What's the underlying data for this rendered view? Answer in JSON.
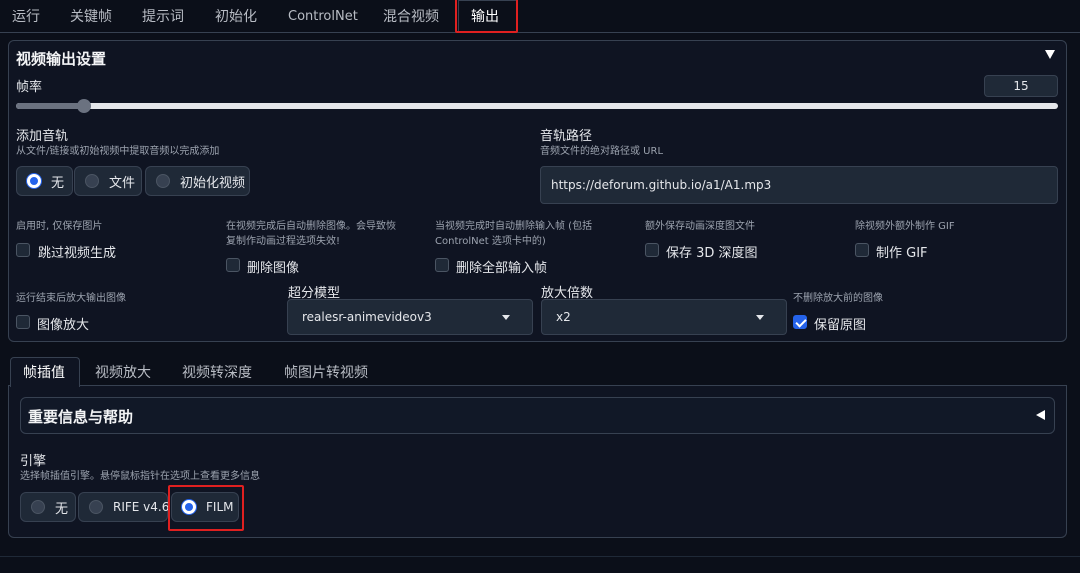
{
  "top_tabs": [
    "运行",
    "关键帧",
    "提示词",
    "初始化",
    "ControlNet",
    "混合视频",
    "输出"
  ],
  "active_top_tab": "输出",
  "output_section": {
    "title": "视频输出设置",
    "fps": {
      "label": "帧率",
      "value": "15",
      "min": 1,
      "max": 200,
      "fraction": 0.065
    },
    "add_audio": {
      "label": "添加音轨",
      "help": "从文件/链接或初始视频中提取音频以完成添加",
      "options": [
        "无",
        "文件",
        "初始化视频"
      ],
      "selected": "无"
    },
    "audio_path": {
      "label": "音轨路径",
      "help": "音频文件的绝对路径或 URL",
      "value": "https://deforum.github.io/a1/A1.mp3"
    },
    "skip_video": {
      "help": "启用时, 仅保存图片",
      "label": "跳过视频生成",
      "checked": false
    },
    "delete_imgs": {
      "help_line1": "在视频完成后自动删除图像。会导致恢",
      "help_line2": "复制作动画过程选项失效!",
      "label": "删除图像",
      "checked": false
    },
    "delete_inputs": {
      "help_line1": "当视频完成时自动删除输入帧 (包括",
      "help_line2": "ControlNet 选项卡中的)",
      "label": "删除全部输入帧",
      "checked": false
    },
    "save_depth": {
      "help": "额外保存动画深度图文件",
      "label": "保存 3D 深度图",
      "checked": false
    },
    "make_gif": {
      "help": "除视频外额外制作 GIF",
      "label": "制作 GIF",
      "checked": false
    },
    "upscale": {
      "help": "运行结束后放大输出图像",
      "label": "图像放大",
      "checked": false
    },
    "upscale_model": {
      "label": "超分模型",
      "value": "realesr-animevideov3"
    },
    "upscale_factor": {
      "label": "放大倍数",
      "value": "x2"
    },
    "keep_original": {
      "help": "不删除放大前的图像",
      "label": "保留原图",
      "checked": true
    }
  },
  "sub_tabs": [
    "帧插值",
    "视频放大",
    "视频转深度",
    "帧图片转视频"
  ],
  "active_sub_tab": "帧插值",
  "frame_interp": {
    "accordion_title": "重要信息与帮助",
    "engine_label": "引擎",
    "engine_help": "选择帧插值引擎。悬停鼠标指针在选项上查看更多信息",
    "engine_options": [
      "无",
      "RIFE v4.6",
      "FILM"
    ],
    "engine_selected": "FILM"
  },
  "colors": {
    "accent": "#2563eb",
    "highlight": "#e02020",
    "background": "#0b0f19"
  }
}
